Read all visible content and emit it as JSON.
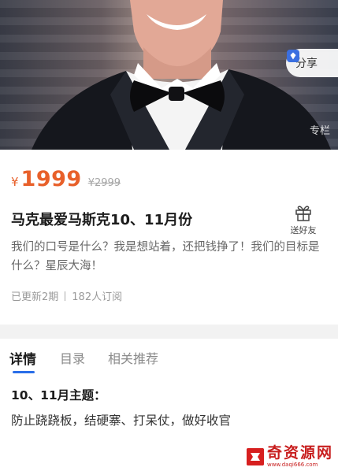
{
  "hero": {
    "share_label": "分享",
    "column_tag": "专栏"
  },
  "product": {
    "currency": "¥",
    "price": "1999",
    "original_price": "¥2999",
    "title": "马克最爱马斯克10、11月份",
    "gift_label": "送好友",
    "description": "我们的口号是什么？我是想站着，还把钱挣了！我们的目标是什么？星辰大海！",
    "updated": "已更新2期",
    "subscribers": "182人订阅"
  },
  "tabs": [
    {
      "label": "详情"
    },
    {
      "label": "目录"
    },
    {
      "label": "相关推荐"
    }
  ],
  "detail": {
    "heading": "10、11月主题：",
    "text": "防止跷跷板，结硬寨、打呆仗，做好收官"
  },
  "watermark": {
    "text": "奇资源网",
    "url": "www.daqi666.com"
  },
  "colors": {
    "price": "#e8602a",
    "tab_indicator": "#2a6ee8",
    "watermark": "#c81e1e"
  }
}
